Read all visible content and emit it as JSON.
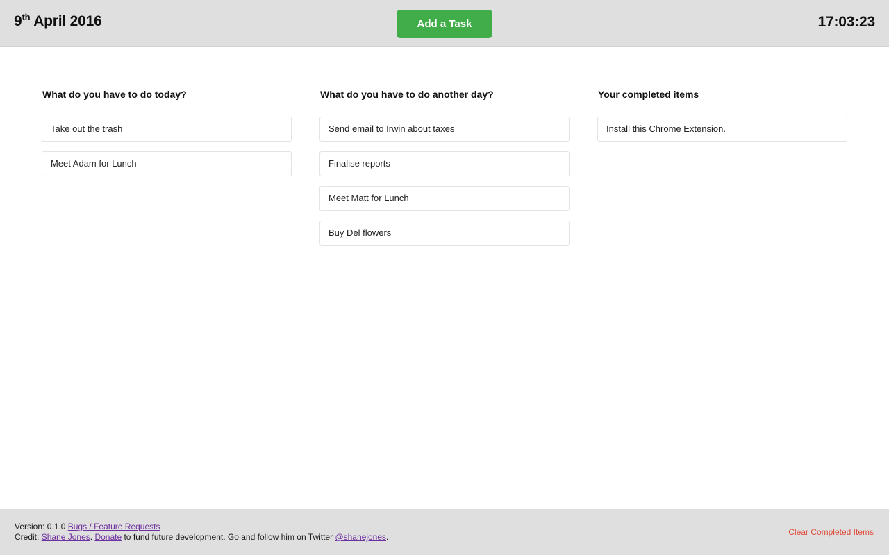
{
  "header": {
    "date_day": "9",
    "date_ordinal": "th",
    "date_rest": " April 2016",
    "add_task_label": "Add a Task",
    "clock": "17:03:23",
    "background_color": "#dfdfdf",
    "accent_color": "#41ad49"
  },
  "columns": [
    {
      "id": "today",
      "title": "What do you have to do today?",
      "tasks": [
        "Take out the trash",
        "Meet Adam for Lunch"
      ]
    },
    {
      "id": "another-day",
      "title": "What do you have to do another day?",
      "tasks": [
        "Send email to Irwin about taxes",
        "Finalise reports",
        "Meet Matt for Lunch",
        "Buy Del flowers"
      ]
    },
    {
      "id": "completed",
      "title": "Your completed items",
      "tasks": [
        "Install this Chrome Extension."
      ]
    }
  ],
  "footer": {
    "version_label": "Version: 0.1.0",
    "bugs_link": "Bugs / Feature Requests",
    "credit_label": "Credit:",
    "author_link": "Shane Jones",
    "after_author": ".",
    "donate_link": "Donate",
    "donate_tail": " to fund future development. Go and follow him on Twitter ",
    "twitter_link": "@shanejones",
    "twitter_tail": ".",
    "clear_completed_label": "Clear Completed Items",
    "link_color": "#6d30a0",
    "danger_color": "#e04b3a"
  }
}
